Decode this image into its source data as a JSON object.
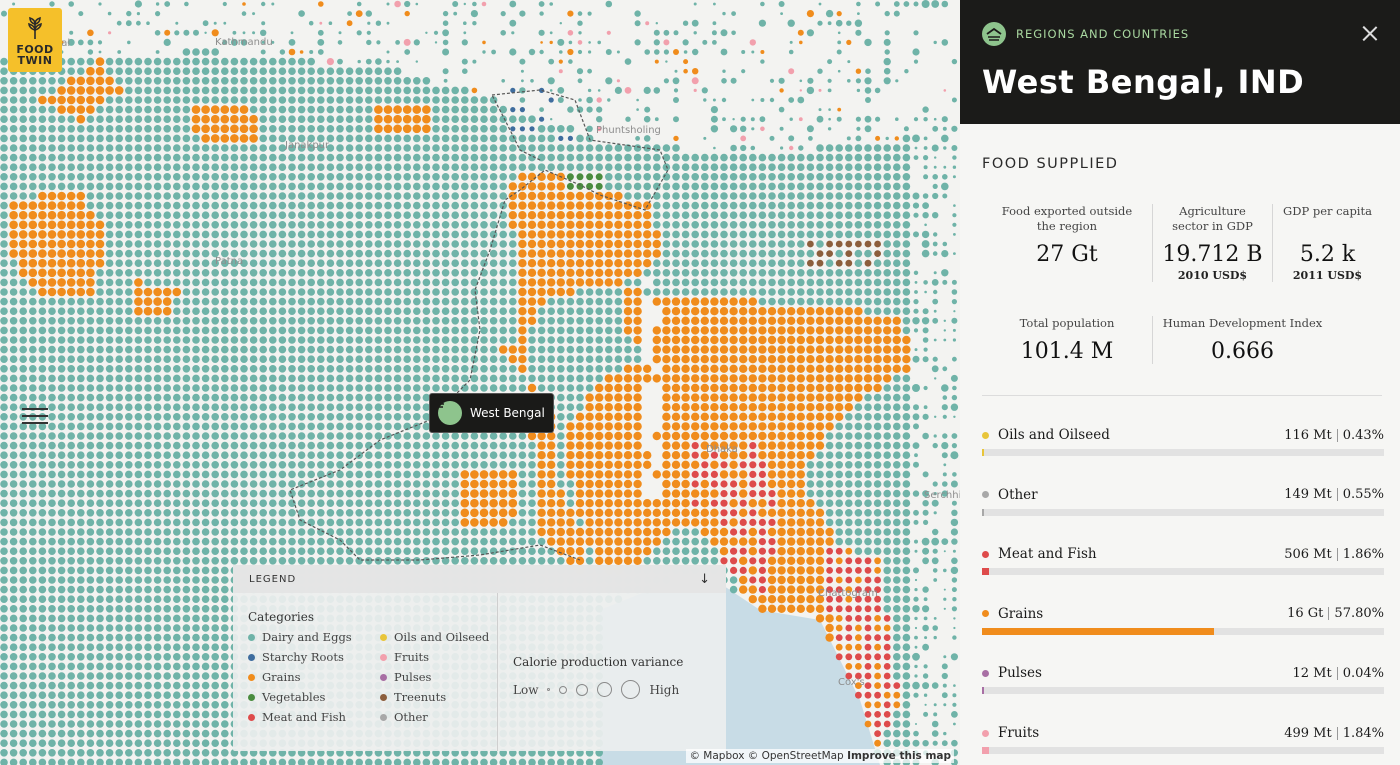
{
  "logo": {
    "line1": "FOOD",
    "line2": "TWIN"
  },
  "map": {
    "tooltip_label": "West Bengal",
    "place_labels": [
      {
        "text": "Butwal",
        "cls": "pl-butwal"
      },
      {
        "text": "Kathmandu",
        "cls": "pl-kathmandu"
      },
      {
        "text": "Phuntsholing",
        "cls": "pl-phuntsholing"
      },
      {
        "text": "Janakpur",
        "cls": "pl-janakpur"
      },
      {
        "text": "Patna",
        "cls": "pl-patna"
      },
      {
        "text": "Dhaka",
        "cls": "pl-dhaka"
      },
      {
        "text": "Chattogram",
        "cls": "pl-chattogram"
      },
      {
        "text": "Serchhip",
        "cls": "pl-serchhip"
      },
      {
        "text": "Cox's",
        "cls": "pl-cox"
      }
    ],
    "attribution": {
      "mapbox": "© Mapbox",
      "osm": "© OpenStreetMap",
      "improve": "Improve this map"
    }
  },
  "legend": {
    "title": "LEGEND",
    "arrow": "↓",
    "categories_title": "Categories",
    "categories": [
      {
        "label": "Dairy and Eggs",
        "color": "#6fb3a8"
      },
      {
        "label": "Oils and Oilseed",
        "color": "#e8c53a"
      },
      {
        "label": "Starchy Roots",
        "color": "#3f6d9e"
      },
      {
        "label": "Fruits",
        "color": "#f2a0ad"
      },
      {
        "label": "Grains",
        "color": "#f08c1c"
      },
      {
        "label": "Pulses",
        "color": "#a86fa4"
      },
      {
        "label": "Vegetables",
        "color": "#4a8c3f"
      },
      {
        "label": "Treenuts",
        "color": "#8c5e3c"
      },
      {
        "label": "Meat and Fish",
        "color": "#de4b4b"
      },
      {
        "label": "Other",
        "color": "#a8a8a8"
      }
    ],
    "variance_title": "Calorie production variance",
    "low": "Low",
    "high": "High"
  },
  "panel": {
    "kicker": "REGIONS AND COUNTRIES",
    "title": "West Bengal, IND",
    "section": "FOOD SUPPLIED",
    "stats_row1": [
      {
        "label": "Food exported outside the region",
        "value": "27 Gt",
        "unit": ""
      },
      {
        "label": "Agriculture sector in GDP",
        "value": "19.712 B",
        "unit": "2010 USD$"
      },
      {
        "label": "GDP per capita",
        "value": "5.2 k",
        "unit": "2011 USD$"
      }
    ],
    "stats_row2": [
      {
        "label": "Total population",
        "value": "101.4 M"
      },
      {
        "label": "Human Development Index",
        "value": "0.666"
      }
    ],
    "food_items": [
      {
        "name": "Oils and Oilseed",
        "amount": "116 Mt",
        "percent": "0.43%",
        "share": 0.43,
        "color": "#e8c53a"
      },
      {
        "name": "Other",
        "amount": "149 Mt",
        "percent": "0.55%",
        "share": 0.55,
        "color": "#a8a8a8"
      },
      {
        "name": "Meat and Fish",
        "amount": "506 Mt",
        "percent": "1.86%",
        "share": 1.86,
        "color": "#de4b4b"
      },
      {
        "name": "Grains",
        "amount": "16 Gt",
        "percent": "57.80%",
        "share": 57.8,
        "color": "#f08c1c"
      },
      {
        "name": "Pulses",
        "amount": "12 Mt",
        "percent": "0.04%",
        "share": 0.04,
        "color": "#a86fa4"
      },
      {
        "name": "Fruits",
        "amount": "499 Mt",
        "percent": "1.84%",
        "share": 1.84,
        "color": "#f2a0ad"
      }
    ]
  }
}
